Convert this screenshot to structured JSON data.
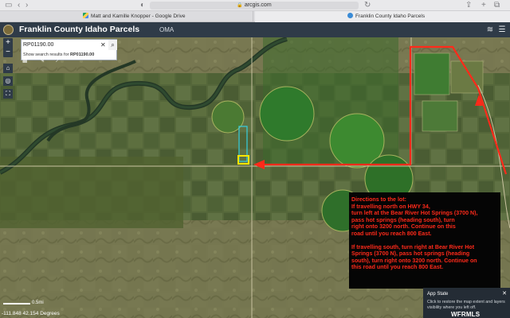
{
  "browser": {
    "url": "arcgis.com",
    "tabs": [
      {
        "label": "Matt and Kamille Knopper - Google Drive",
        "icon": "google-drive-icon"
      },
      {
        "label": "Franklin County Idaho Parcels",
        "icon": "arcgis-icon"
      }
    ]
  },
  "app": {
    "title": "Franklin County Idaho Parcels",
    "center_label": "OMA"
  },
  "search": {
    "value": "RP01190.00",
    "hint_prefix": "Show search results for",
    "hint_term": "RP01190.00"
  },
  "directions": {
    "para1": [
      "Directions to the lot:",
      "If travelling north on HWY 34,",
      "turn left at the Bear River Hot Springs (3700 N),",
      "pass hot springs (heading south),  turn",
      "right onto 3200 north.  Continue on this",
      "road until you reach 800 East."
    ],
    "para2": [
      "If travelling south, turn right at Bear River Hot",
      "Springs (3700 N), pass hot springs (heading",
      "south), turn right onto 3200 north.  Continue on",
      "this road until you reach 800 East."
    ]
  },
  "app_state": {
    "title": "App State",
    "body": "Click to restore the map extent and layers visibility where you left off."
  },
  "status": {
    "coords": "-111.848 42.154 Degrees",
    "scale_label": "0.5mi"
  },
  "watermark": "WFRMLS",
  "colors": {
    "header_bg": "#2f3b48",
    "route_red": "#ff2a1a",
    "highlight_yellow": "#ffe600",
    "parcel_cyan": "#35d0e0"
  }
}
